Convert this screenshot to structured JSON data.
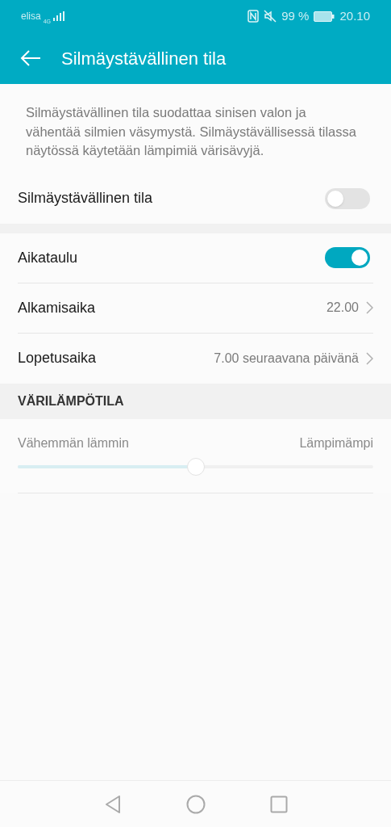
{
  "status_bar": {
    "carrier": "elisa",
    "network": "4G",
    "battery": "99 %",
    "time": "20.10"
  },
  "header": {
    "title": "Silmäystävällinen tila"
  },
  "description": "Silmäystävällinen tila suodattaa sinisen valon ja vähentää silmien väsymystä. Silmäystävällisessä tilassa näytössä käytetään lämpimiä värisävyjä.",
  "main_toggle": {
    "label": "Silmäystävällinen tila",
    "on": false
  },
  "schedule": [
    {
      "kind": "toggle",
      "label": "Aikataulu",
      "on": true
    },
    {
      "kind": "link",
      "label": "Alkamisaika",
      "value": "22.00"
    },
    {
      "kind": "link",
      "label": "Lopetusaika",
      "value": "7.00 seuraavana päivänä"
    }
  ],
  "color_temperature": {
    "heading": "VÄRILÄMPÖTILA",
    "min_label": "Vähemmän lämmin",
    "max_label": "Lämpimämpi",
    "level": 0.5
  }
}
